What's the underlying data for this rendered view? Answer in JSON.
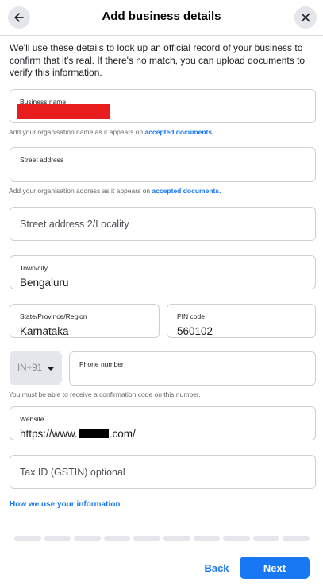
{
  "header": {
    "title": "Add business details",
    "back_icon": "arrow-left-icon",
    "close_icon": "close-icon"
  },
  "intro": "We'll use these details to look up an official record of your business to confirm that it's real. If there's no match, you can upload documents to verify this information.",
  "fields": {
    "business_name": {
      "label": "Business name",
      "value_redacted": true
    },
    "business_name_helper": {
      "text": "Add your organisation name as it appears on ",
      "link": "accepted documents."
    },
    "street_address": {
      "label": "Street address",
      "value": ""
    },
    "street_address_helper": {
      "text": "Add your organisation address as it appears on ",
      "link": "accepted documents."
    },
    "street_address_2": {
      "placeholder": "Street address 2/Locality"
    },
    "town_city": {
      "label": "Town/city",
      "value": "Bengaluru"
    },
    "state": {
      "label": "State/Province/Region",
      "value": "Karnataka"
    },
    "pin_code": {
      "label": "PIN code",
      "value": "560102"
    },
    "country_code": {
      "value": "IN+91"
    },
    "phone": {
      "label": "Phone number",
      "value": ""
    },
    "phone_helper": "You must be able to receive a confirmation code on this number.",
    "website": {
      "label": "Website",
      "value_prefix": "https://www.",
      "value_suffix": ".com/"
    },
    "tax_id": {
      "placeholder": "Tax ID (GSTIN) optional"
    }
  },
  "how_we_use_link": "How we use your information",
  "progress": {
    "steps": 10
  },
  "footer": {
    "back_label": "Back",
    "next_label": "Next"
  },
  "colors": {
    "accent": "#1877f2",
    "redaction_red": "#e81e1e"
  }
}
